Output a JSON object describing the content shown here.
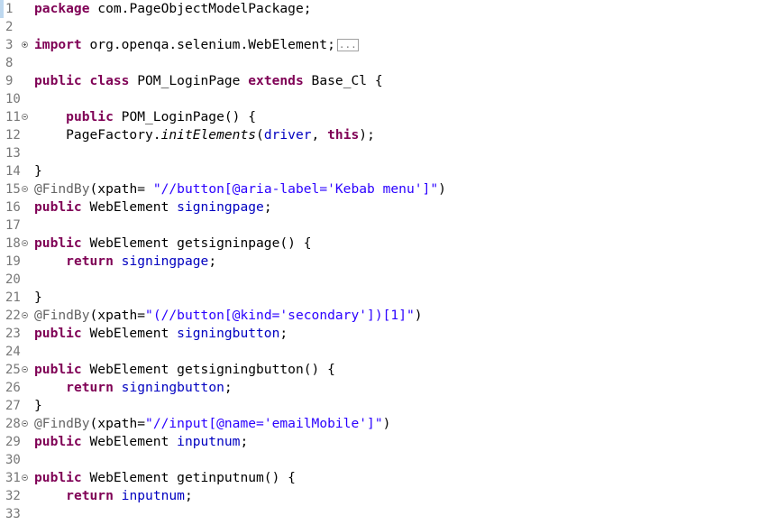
{
  "editor": {
    "lines": [
      {
        "n": "1",
        "fold": "",
        "tokens": [
          [
            "kw",
            "package"
          ],
          [
            "txt",
            " com.PageObjectModelPackage;"
          ]
        ]
      },
      {
        "n": "2",
        "fold": "",
        "tokens": []
      },
      {
        "n": "3",
        "fold": "plus",
        "tokens": [
          [
            "kw",
            "import"
          ],
          [
            "txt",
            " org.openqa.selenium.WebElement;"
          ],
          [
            "collapsed",
            "..."
          ]
        ]
      },
      {
        "n": "8",
        "fold": "",
        "tokens": []
      },
      {
        "n": "9",
        "fold": "",
        "tokens": [
          [
            "kw",
            "public"
          ],
          [
            "txt",
            " "
          ],
          [
            "kw",
            "class"
          ],
          [
            "txt",
            " POM_LoginPage "
          ],
          [
            "kw",
            "extends"
          ],
          [
            "txt",
            " Base_Cl {"
          ]
        ]
      },
      {
        "n": "10",
        "fold": "",
        "tokens": []
      },
      {
        "n": "11",
        "fold": "minus",
        "tokens": [
          [
            "txt",
            "    "
          ],
          [
            "kw",
            "public"
          ],
          [
            "txt",
            " POM_LoginPage() {"
          ]
        ]
      },
      {
        "n": "12",
        "fold": "",
        "tokens": [
          [
            "txt",
            "    PageFactory."
          ],
          [
            "static",
            "initElements"
          ],
          [
            "txt",
            "("
          ],
          [
            "field",
            "driver"
          ],
          [
            "txt",
            ", "
          ],
          [
            "kw",
            "this"
          ],
          [
            "txt",
            ");"
          ]
        ]
      },
      {
        "n": "13",
        "fold": "",
        "tokens": []
      },
      {
        "n": "14",
        "fold": "",
        "tokens": [
          [
            "txt",
            "}"
          ]
        ]
      },
      {
        "n": "15",
        "fold": "minus",
        "tokens": [
          [
            "anno",
            "@FindBy"
          ],
          [
            "txt",
            "(xpath= "
          ],
          [
            "str",
            "\"//button[@aria-label='Kebab menu']\""
          ],
          [
            "txt",
            ")"
          ]
        ]
      },
      {
        "n": "16",
        "fold": "",
        "tokens": [
          [
            "kw",
            "public"
          ],
          [
            "txt",
            " WebElement "
          ],
          [
            "field",
            "signingpage"
          ],
          [
            "txt",
            ";"
          ]
        ]
      },
      {
        "n": "17",
        "fold": "",
        "tokens": []
      },
      {
        "n": "18",
        "fold": "minus",
        "tokens": [
          [
            "kw",
            "public"
          ],
          [
            "txt",
            " WebElement getsigninpage() {"
          ]
        ]
      },
      {
        "n": "19",
        "fold": "",
        "tokens": [
          [
            "txt",
            "    "
          ],
          [
            "kw",
            "return"
          ],
          [
            "txt",
            " "
          ],
          [
            "field",
            "signingpage"
          ],
          [
            "txt",
            ";"
          ]
        ]
      },
      {
        "n": "20",
        "fold": "",
        "tokens": []
      },
      {
        "n": "21",
        "fold": "",
        "tokens": [
          [
            "txt",
            "}"
          ]
        ]
      },
      {
        "n": "22",
        "fold": "minus",
        "tokens": [
          [
            "anno",
            "@FindBy"
          ],
          [
            "txt",
            "(xpath="
          ],
          [
            "str",
            "\"(//button[@kind='secondary'])[1]\""
          ],
          [
            "txt",
            ")"
          ]
        ]
      },
      {
        "n": "23",
        "fold": "",
        "tokens": [
          [
            "kw",
            "public"
          ],
          [
            "txt",
            " WebElement "
          ],
          [
            "field",
            "signingbutton"
          ],
          [
            "txt",
            ";"
          ]
        ]
      },
      {
        "n": "24",
        "fold": "",
        "tokens": []
      },
      {
        "n": "25",
        "fold": "minus",
        "tokens": [
          [
            "kw",
            "public"
          ],
          [
            "txt",
            " WebElement getsigningbutton() {"
          ]
        ]
      },
      {
        "n": "26",
        "fold": "",
        "tokens": [
          [
            "txt",
            "    "
          ],
          [
            "kw",
            "return"
          ],
          [
            "txt",
            " "
          ],
          [
            "field",
            "signingbutton"
          ],
          [
            "txt",
            ";"
          ]
        ]
      },
      {
        "n": "27",
        "fold": "",
        "tokens": [
          [
            "txt",
            "}"
          ]
        ]
      },
      {
        "n": "28",
        "fold": "minus",
        "tokens": [
          [
            "anno",
            "@FindBy"
          ],
          [
            "txt",
            "(xpath="
          ],
          [
            "str",
            "\"//input[@name='emailMobile']\""
          ],
          [
            "txt",
            ")"
          ]
        ]
      },
      {
        "n": "29",
        "fold": "",
        "tokens": [
          [
            "kw",
            "public"
          ],
          [
            "txt",
            " WebElement "
          ],
          [
            "field",
            "inputnum"
          ],
          [
            "txt",
            ";"
          ]
        ]
      },
      {
        "n": "30",
        "fold": "",
        "tokens": []
      },
      {
        "n": "31",
        "fold": "minus",
        "tokens": [
          [
            "kw",
            "public"
          ],
          [
            "txt",
            " WebElement getinputnum() {"
          ]
        ]
      },
      {
        "n": "32",
        "fold": "",
        "tokens": [
          [
            "txt",
            "    "
          ],
          [
            "kw",
            "return"
          ],
          [
            "txt",
            " "
          ],
          [
            "field",
            "inputnum"
          ],
          [
            "txt",
            ";"
          ]
        ]
      },
      {
        "n": "33",
        "fold": "",
        "tokens": []
      }
    ]
  },
  "colors": {
    "keyword": "#7f0055",
    "string": "#2a00ff",
    "field": "#0000c0",
    "annotation": "#646464",
    "line_number": "#787878"
  }
}
